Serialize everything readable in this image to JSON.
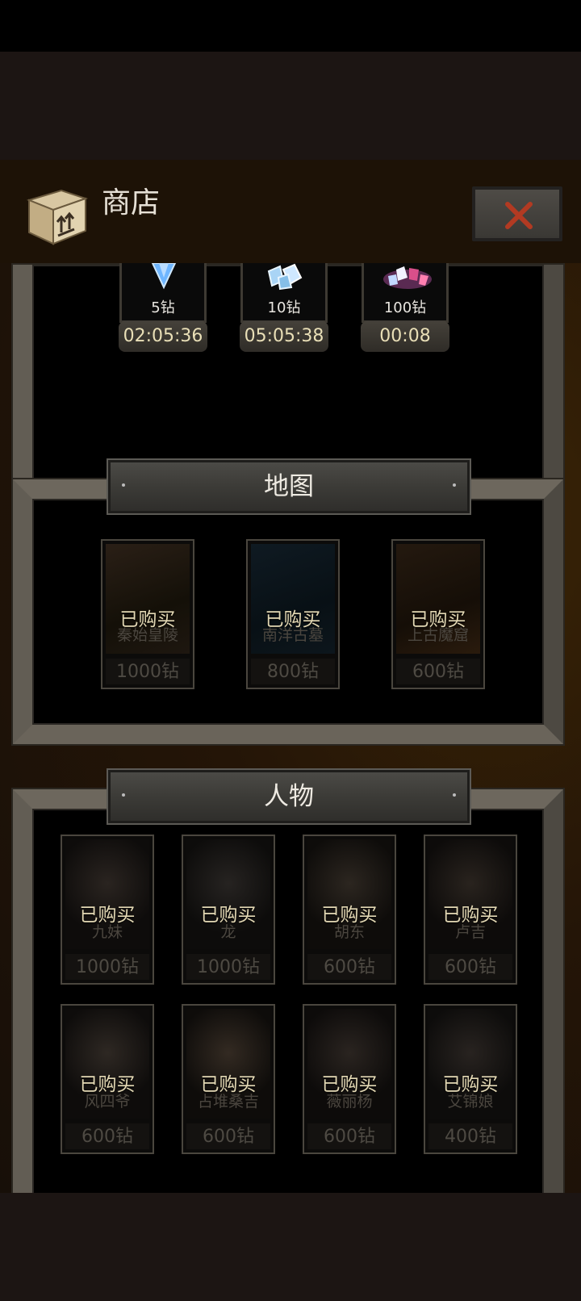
{
  "header": {
    "title": "商店",
    "close_icon": "close-x-icon"
  },
  "colors": {
    "accent_close": "#b23a22",
    "bought_text": "#e3d8b4",
    "price_text": "#4e4a43"
  },
  "diamonds": [
    {
      "amount": "5钻",
      "timer": "02:05:36",
      "icon": "blue-diamond-icon"
    },
    {
      "amount": "10钻",
      "timer": "05:05:38",
      "icon": "ice-crystals-icon"
    },
    {
      "amount": "100钻",
      "timer": "00:08",
      "icon": "gem-pile-icon"
    }
  ],
  "maps": {
    "title": "地图",
    "items": [
      {
        "name": "秦始皇陵",
        "status": "已购买",
        "price": "1000钻"
      },
      {
        "name": "南洋古墓",
        "status": "已购买",
        "price": "800钻"
      },
      {
        "name": "上古魔窟",
        "status": "已购买",
        "price": "600钻"
      }
    ]
  },
  "characters": {
    "title": "人物",
    "items": [
      {
        "name": "九妹",
        "status": "已购买",
        "price": "1000钻"
      },
      {
        "name": "龙",
        "status": "已购买",
        "price": "1000钻"
      },
      {
        "name": "胡东",
        "status": "已购买",
        "price": "600钻"
      },
      {
        "name": "卢吉",
        "status": "已购买",
        "price": "600钻"
      },
      {
        "name": "风四爷",
        "status": "已购买",
        "price": "600钻"
      },
      {
        "name": "占堆桑吉",
        "status": "已购买",
        "price": "600钻"
      },
      {
        "name": "薇丽杨",
        "status": "已购买",
        "price": "600钻"
      },
      {
        "name": "艾锦娘",
        "status": "已购买",
        "price": "400钻"
      }
    ]
  }
}
